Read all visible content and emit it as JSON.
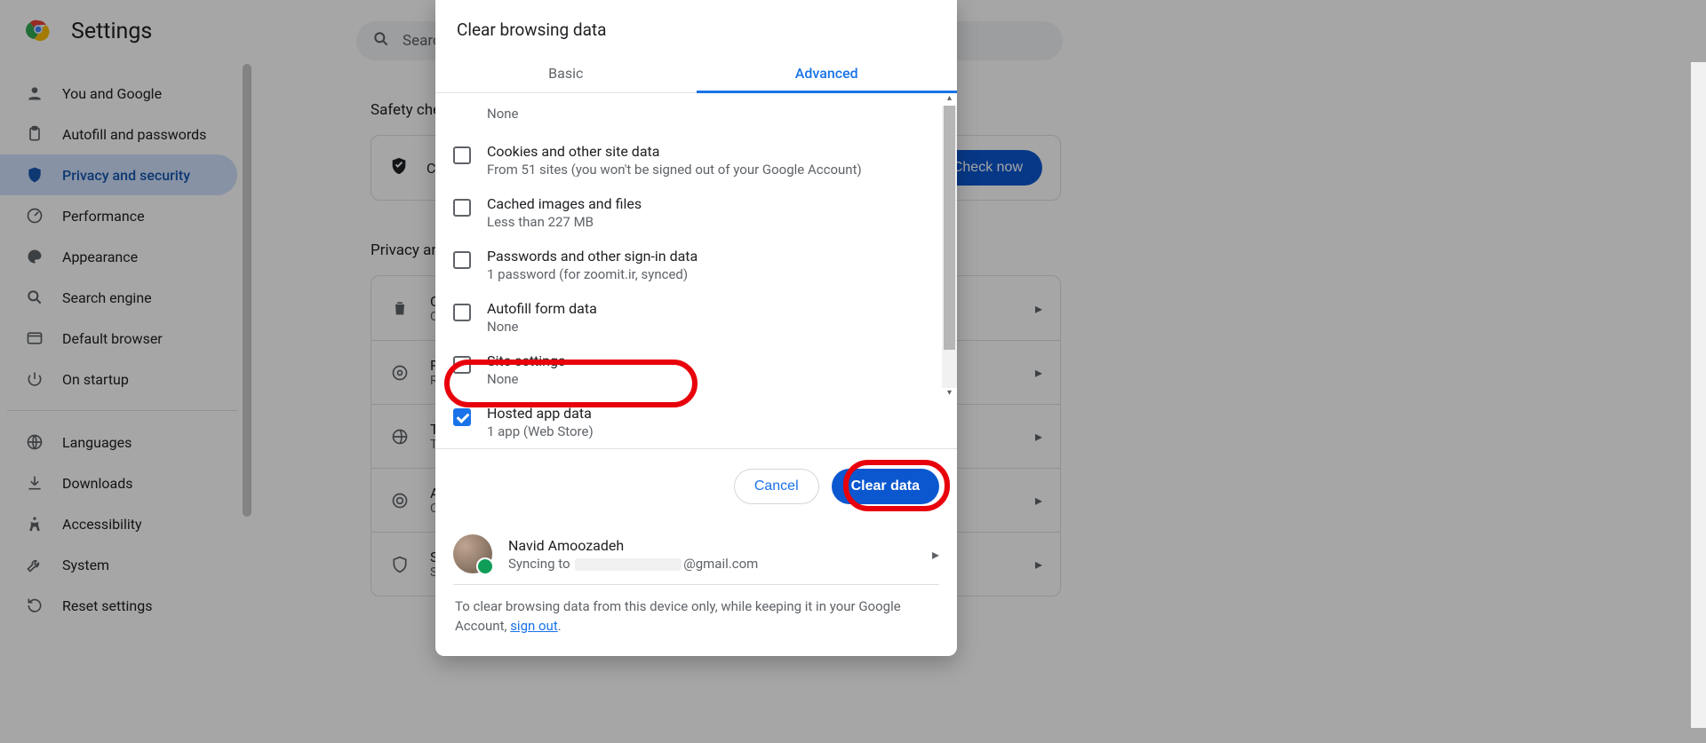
{
  "brand": {
    "title": "Settings"
  },
  "search": {
    "placeholder": "Search"
  },
  "sidebar": {
    "items": [
      {
        "label": "You and Google",
        "icon": "person-icon"
      },
      {
        "label": "Autofill and passwords",
        "icon": "clipboard-icon"
      },
      {
        "label": "Privacy and security",
        "icon": "shield-icon",
        "active": true
      },
      {
        "label": "Performance",
        "icon": "gauge-icon"
      },
      {
        "label": "Appearance",
        "icon": "palette-icon"
      },
      {
        "label": "Search engine",
        "icon": "search-icon"
      },
      {
        "label": "Default browser",
        "icon": "browser-icon"
      },
      {
        "label": "On startup",
        "icon": "power-icon"
      }
    ],
    "items2": [
      {
        "label": "Languages",
        "icon": "globe-icon"
      },
      {
        "label": "Downloads",
        "icon": "download-icon"
      },
      {
        "label": "Accessibility",
        "icon": "accessibility-icon"
      },
      {
        "label": "System",
        "icon": "wrench-icon"
      },
      {
        "label": "Reset settings",
        "icon": "reset-icon"
      }
    ]
  },
  "sections": {
    "safety_check": "Safety check",
    "privacy": "Privacy and security",
    "check_now": "Check now",
    "chrome_safe_partial": "C"
  },
  "privacy_rows": [
    {
      "initial": "C",
      "sub": "C",
      "icon": "trash-icon"
    },
    {
      "initial": "P",
      "sub": "R",
      "icon": "tune-icon"
    },
    {
      "initial": "T",
      "sub": "T",
      "icon": "cookie-icon"
    },
    {
      "initial": "A",
      "sub": "C",
      "icon": "target-icon"
    },
    {
      "initial": "S",
      "sub": "S",
      "icon": "shield-check-icon"
    }
  ],
  "dialog": {
    "title": "Clear browsing data",
    "tabs": {
      "basic": "Basic",
      "advanced": "Advanced"
    },
    "options": [
      {
        "title": "",
        "sub": "None",
        "checked": false,
        "first": true
      },
      {
        "title": "Cookies and other site data",
        "sub": "From 51 sites (you won't be signed out of your Google Account)",
        "checked": false
      },
      {
        "title": "Cached images and files",
        "sub": "Less than 227 MB",
        "checked": false
      },
      {
        "title": "Passwords and other sign-in data",
        "sub": "1 password (for zoomit.ir, synced)",
        "checked": false
      },
      {
        "title": "Autofill form data",
        "sub": "None",
        "checked": false
      },
      {
        "title": "Site settings",
        "sub": "None",
        "checked": false
      },
      {
        "title": "Hosted app data",
        "sub": "1 app (Web Store)",
        "checked": true
      }
    ],
    "cancel": "Cancel",
    "clear": "Clear data",
    "account": {
      "name": "Navid Amoozadeh",
      "sync_prefix": "Syncing to",
      "email_suffix": "@gmail.com"
    },
    "note_before": "To clear browsing data from this device only, while keeping it in your Google Account, ",
    "note_link": "sign out",
    "note_after": "."
  }
}
